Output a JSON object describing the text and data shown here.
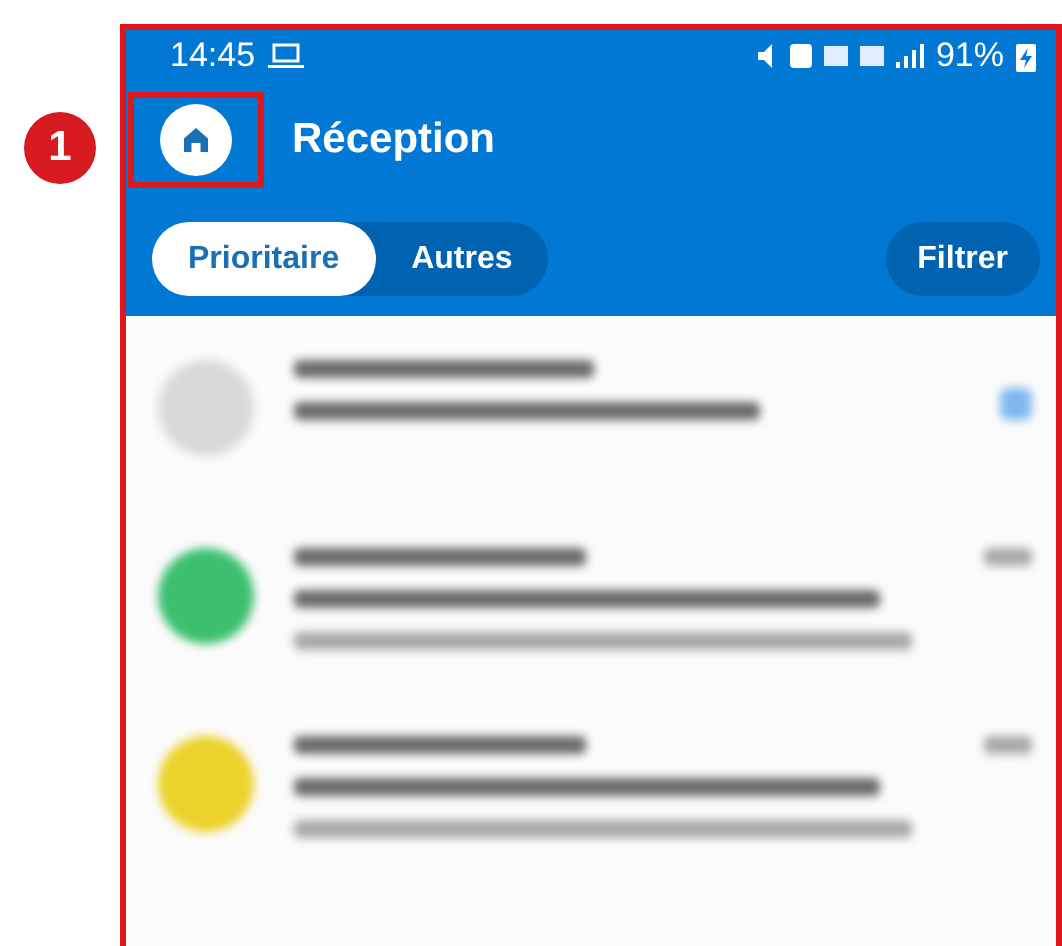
{
  "callout": {
    "number": "1"
  },
  "status_bar": {
    "time": "14:45",
    "battery": "91%"
  },
  "header": {
    "title": "Réception"
  },
  "tabs": [
    {
      "label": "Prioritaire",
      "selected": true
    },
    {
      "label": "Autres",
      "selected": false
    }
  ],
  "filter_button": "Filtrer",
  "messages": [
    {
      "kind": "two-line",
      "color": "#d9d9d9",
      "unread": true
    },
    {
      "kind": "three-line",
      "color": "#3cc06f",
      "unread": false
    },
    {
      "kind": "three-line",
      "color": "#ecd22a",
      "unread": false
    }
  ]
}
